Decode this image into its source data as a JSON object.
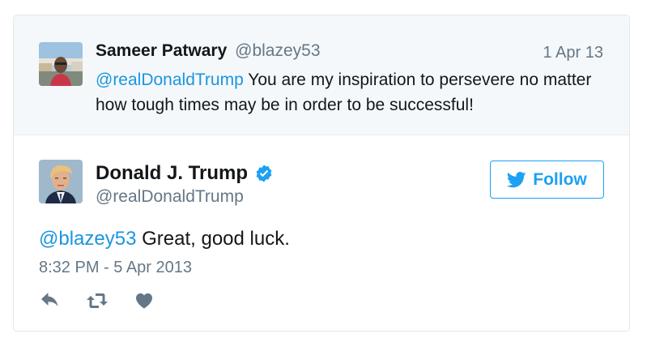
{
  "parent_tweet": {
    "author_name": "Sameer Patwary",
    "author_handle": "@blazey53",
    "date": "1 Apr 13",
    "mention": "@realDonaldTrump",
    "text": " You are my inspiration to persevere no matter how tough times may be in order to be successful!"
  },
  "tweet": {
    "author_name": "Donald J. Trump",
    "author_handle": "@realDonaldTrump",
    "verified": true,
    "mention": "@blazey53",
    "text": " Great, good luck.",
    "timestamp": "8:32 PM - 5 Apr 2013"
  },
  "follow_button": {
    "label": "Follow",
    "icon": "twitter-bird-icon"
  },
  "actions": [
    {
      "name": "reply",
      "icon": "reply-icon"
    },
    {
      "name": "retweet",
      "icon": "retweet-icon"
    },
    {
      "name": "like",
      "icon": "heart-icon"
    }
  ],
  "colors": {
    "link": "#1b95e0",
    "accent": "#1da1f2",
    "muted_text": "#657786",
    "parent_background": "#f5f8fa",
    "border": "#e1e8ed"
  }
}
